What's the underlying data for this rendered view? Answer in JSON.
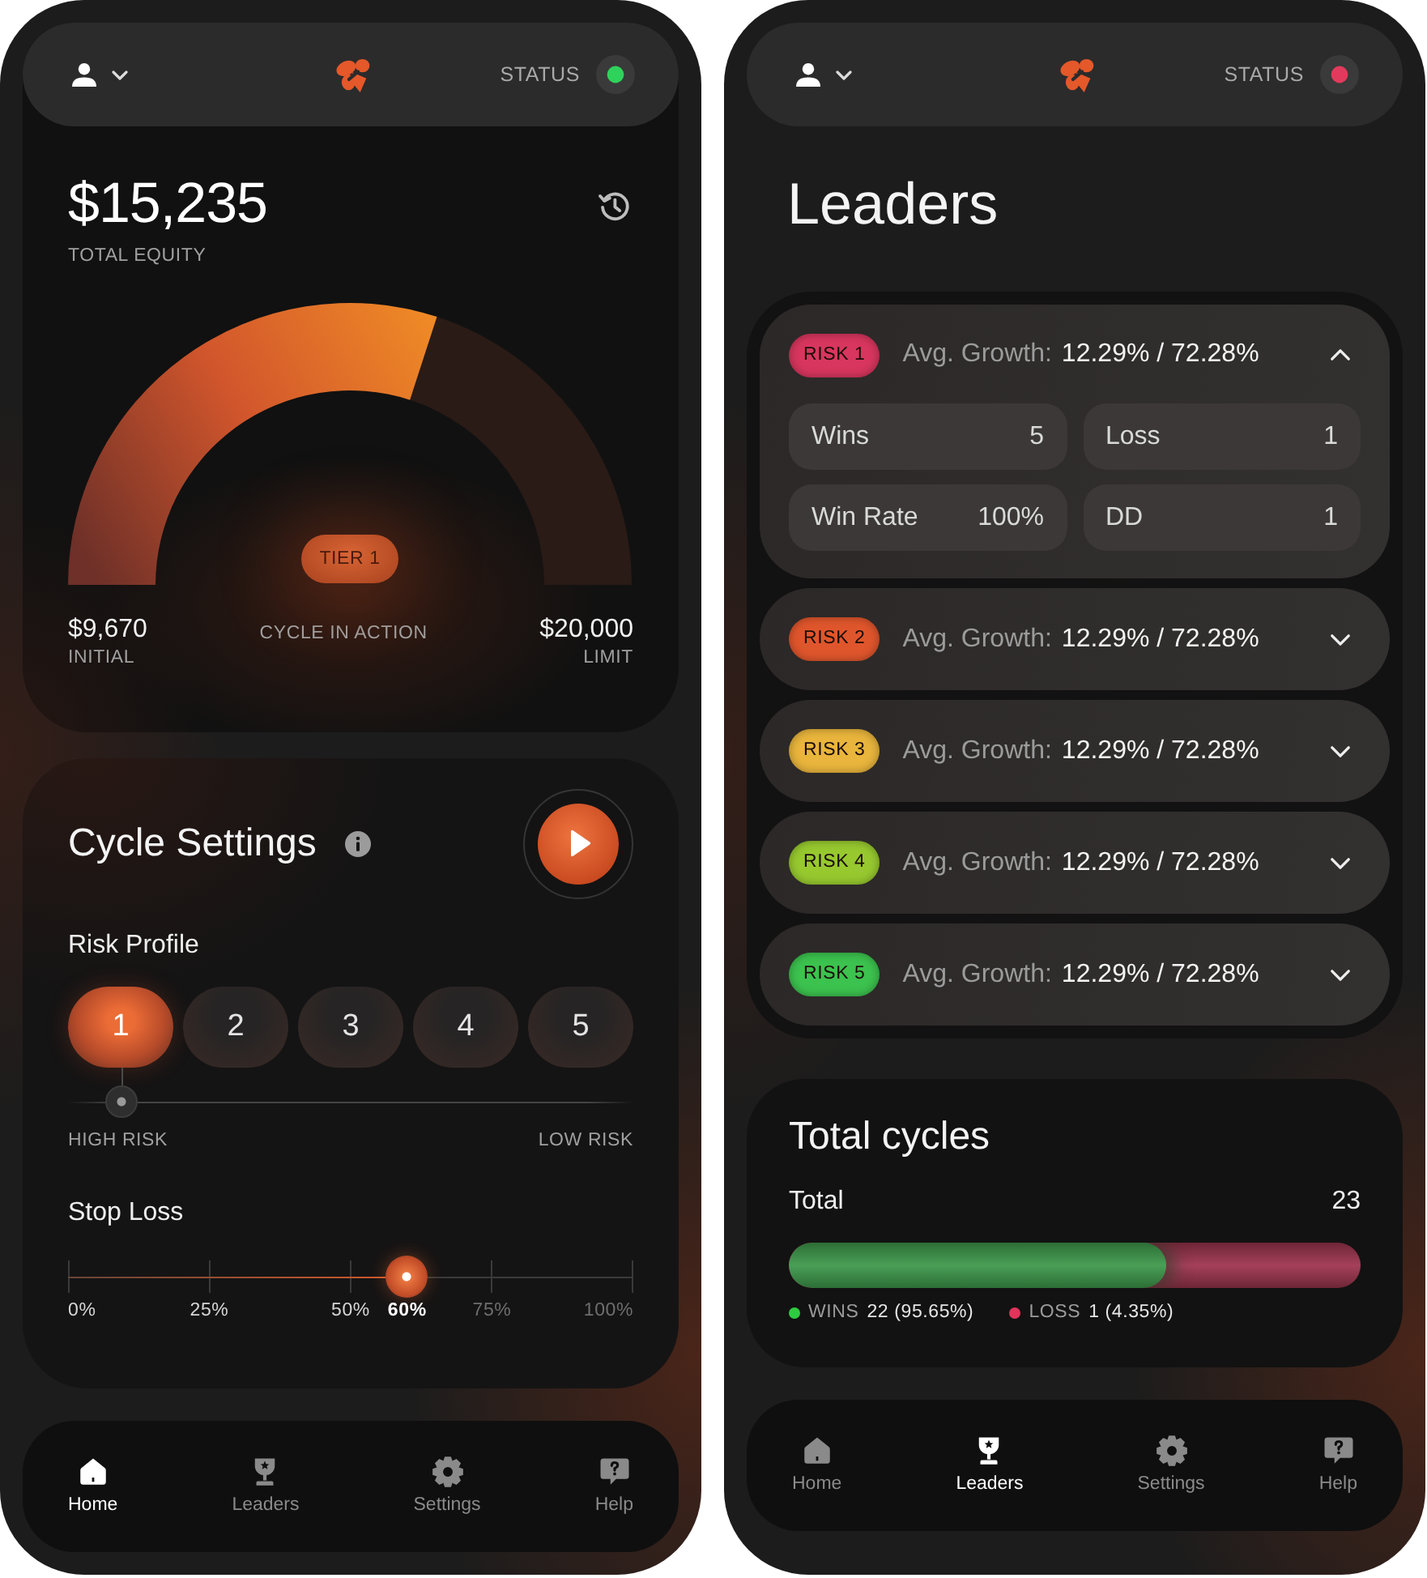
{
  "home_screen": {
    "header": {
      "status_label": "STATUS",
      "online": true
    },
    "equity": {
      "amount": "$15,235",
      "amount_label": "TOTAL EQUITY",
      "gauge": {
        "level": 0.6,
        "tier": "TIER 1"
      },
      "initial_value": "$9,670",
      "initial_label": "INITIAL",
      "center_label": "CYCLE IN ACTION",
      "limit_value": "$20,000",
      "limit_label": "LIMIT"
    },
    "cycle_settings": {
      "title": "Cycle Settings",
      "risk_profile": {
        "label": "Risk Profile",
        "options": [
          {
            "label": "1",
            "selected": true
          },
          {
            "label": "2",
            "selected": false
          },
          {
            "label": "3",
            "selected": false
          },
          {
            "label": "4",
            "selected": false
          },
          {
            "label": "5",
            "selected": false
          }
        ],
        "high_label": "HIGH RISK",
        "low_label": "LOW RISK"
      },
      "stop_loss": {
        "label": "Stop Loss",
        "level": 0.6,
        "value": "60%",
        "ticks": [
          "0%",
          "25%",
          "50%",
          "75%",
          "100%"
        ]
      }
    },
    "nav": [
      {
        "label": "Home",
        "selected": true
      },
      {
        "label": "Leaders",
        "selected": false
      },
      {
        "label": "Settings",
        "selected": false
      },
      {
        "label": "Help",
        "selected": false
      }
    ]
  },
  "leaders_screen": {
    "header": {
      "status_label": "STATUS",
      "online": false
    },
    "title": "Leaders",
    "leaders": [
      {
        "badge": "RISK 1",
        "color": "#d8365e",
        "growth_label": "Avg. Growth:",
        "growth_value": "12.29% / 72.28%",
        "expanded": true,
        "stats": [
          {
            "label": "Wins",
            "value": "5"
          },
          {
            "label": "Loss",
            "value": "1"
          },
          {
            "label": "Win Rate",
            "value": "100%"
          },
          {
            "label": "DD",
            "value": "1"
          }
        ]
      },
      {
        "badge": "RISK 2",
        "color": "#e0562c",
        "growth_label": "Avg. Growth:",
        "growth_value": "12.29% / 72.28%",
        "expanded": false
      },
      {
        "badge": "RISK 3",
        "color": "#e9b53c",
        "growth_label": "Avg. Growth:",
        "growth_value": "12.29% / 72.28%",
        "expanded": false
      },
      {
        "badge": "RISK 4",
        "color": "#97c92f",
        "growth_label": "Avg. Growth:",
        "growth_value": "12.29% / 72.28%",
        "expanded": false
      },
      {
        "badge": "RISK 5",
        "color": "#3cc24e",
        "growth_label": "Avg. Growth:",
        "growth_value": "12.29% / 72.28%",
        "expanded": false
      }
    ],
    "total_cycles": {
      "title": "Total cycles",
      "total_label": "Total",
      "total_value": "23",
      "level": 0.66,
      "legend": [
        {
          "label": "WINS",
          "value": "22 (95.65%)",
          "color": "#2ecc40"
        },
        {
          "label": "LOSS",
          "value": "1 (4.35%)",
          "color": "#e0345a"
        }
      ]
    },
    "nav": [
      {
        "label": "Home",
        "selected": false
      },
      {
        "label": "Leaders",
        "selected": true
      },
      {
        "label": "Settings",
        "selected": false
      },
      {
        "label": "Help",
        "selected": false
      }
    ]
  }
}
